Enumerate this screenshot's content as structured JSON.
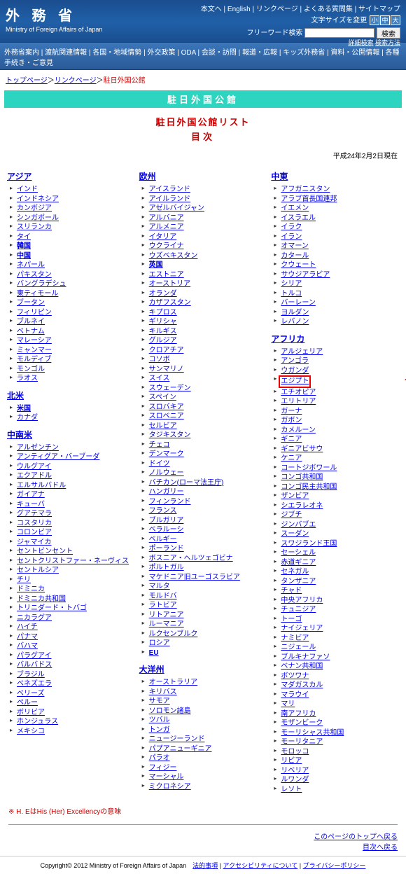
{
  "header": {
    "title": "外 務 省",
    "sub": "Ministry of Foreign Affairs of Japan",
    "topLinks": [
      "本文へ",
      "English",
      "リンクページ",
      "よくある質問集",
      "サイトマップ"
    ],
    "fontLabel": "文字サイズを変更",
    "fontBtns": [
      "小",
      "中",
      "大"
    ],
    "searchLabel": "フリーワード検索",
    "searchBtn": "検索",
    "searchSub": [
      "詳細検索",
      "検索方法"
    ]
  },
  "nav": [
    "外務省案内",
    "渡航関連情報",
    "各国・地域情勢",
    "外交政策",
    "ODA",
    "会談・訪問",
    "報道・広報",
    "キッズ外務省",
    "資料・公開情報",
    "各種手続き・ご意見"
  ],
  "bc": {
    "links": [
      "トップページ",
      "リンクページ"
    ],
    "cur": "駐日外国公館"
  },
  "banner": "駐日外国公館",
  "mainTitle": "駐日外国公館リスト",
  "subTitle": "目次",
  "date": "平成24年2月2日現在",
  "regions": {
    "asia": {
      "h": "アジア",
      "items": [
        "インド",
        "インドネシア",
        "カンボジア",
        "シンガポール",
        "スリランカ",
        "タイ",
        "韓国",
        "中国",
        "ネパール",
        "パキスタン",
        "バングラデシュ",
        "東ティモール",
        "ブータン",
        "フィリピン",
        "ブルネイ",
        "ベトナム",
        "マレーシア",
        "ミャンマー",
        "モルディブ",
        "モンゴル",
        "ラオス"
      ]
    },
    "na": {
      "h": "北米",
      "items": [
        "米国",
        "カナダ"
      ]
    },
    "la": {
      "h": "中南米",
      "items": [
        "アルゼンチン",
        "アンティグア・バーブーダ",
        "ウルグアイ",
        "エクアドル",
        "エルサルバドル",
        "ガイアナ",
        "キューバ",
        "グアテマラ",
        "コスタリカ",
        "コロンビア",
        "ジャマイカ",
        "セントビンセント",
        "セントクリストファー・ネーヴィス",
        "セントルシア",
        "チリ",
        "ドミニカ",
        "ドミニカ共和国",
        "トリニダード・トバゴ",
        "ニカラグア",
        "ハイチ",
        "パナマ",
        "バハマ",
        "パラグアイ",
        "バルバドス",
        "ブラジル",
        "ベネズエラ",
        "ベリーズ",
        "ペルー",
        "ボリビア",
        "ホンジュラス",
        "メキシコ"
      ]
    },
    "eu": {
      "h": "欧州",
      "items": [
        "アイスランド",
        "アイルランド",
        "アゼルバイジャン",
        "アルバニア",
        "アルメニア",
        "イタリア",
        "ウクライナ",
        "ウズベキスタン",
        "英国",
        "エストニア",
        "オーストリア",
        "オランダ",
        "カザフスタン",
        "キプロス",
        "ギリシャ",
        "キルギス",
        "グルジア",
        "クロアチア",
        "コソボ",
        "サンマリノ",
        "スイス",
        "スウェーデン",
        "スペイン",
        "スロバキア",
        "スロベニア",
        "セルビア",
        "タジキスタン",
        "チェコ",
        "デンマーク",
        "ドイツ",
        "ノルウェー",
        "バチカン(ローマ法王庁)",
        "ハンガリー",
        "フィンランド",
        "フランス",
        "ブルガリア",
        "ベラルーシ",
        "ベルギー",
        "ポーランド",
        "ボスニア・ヘルツェゴビナ",
        "ポルトガル",
        "マケドニア旧ユーゴスラビア",
        "マルタ",
        "モルドバ",
        "ラトビア",
        "リトアニア",
        "ルーマニア",
        "ルクセンブルク",
        "ロシア",
        "EU"
      ]
    },
    "oc": {
      "h": "大洋州",
      "items": [
        "オーストラリア",
        "キリバス",
        "サモア",
        "ソロモン諸島",
        "ツバル",
        "トンガ",
        "ニュージーランド",
        "パプアニューギニア",
        "パラオ",
        "フィジー",
        "マーシャル",
        "ミクロネシア"
      ]
    },
    "me": {
      "h": "中東",
      "items": [
        "アフガニスタン",
        "アラブ首長国連邦",
        "イエメン",
        "イスラエル",
        "イラク",
        "イラン",
        "オマーン",
        "カタール",
        "クウェート",
        "サウジアラビア",
        "シリア",
        "トルコ",
        "バーレーン",
        "ヨルダン",
        "レバノン"
      ]
    },
    "af": {
      "h": "アフリカ",
      "items": [
        "アルジェリア",
        "アンゴラ",
        "ウガンダ",
        "エジプト",
        "エチオピア",
        "エリトリア",
        "ガーナ",
        "ガボン",
        "カメルーン",
        "ギニア",
        "ギニアビサウ",
        "ケニア",
        "コートジボワール",
        "コンゴ共和国",
        "コンゴ民主共和国",
        "ザンビア",
        "シエラレオネ",
        "ジブチ",
        "ジンバブエ",
        "スーダン",
        "スワジランド王国",
        "セーシェル",
        "赤道ギニア",
        "セネガル",
        "タンザニア",
        "チャド",
        "中央アフリカ",
        "チュニジア",
        "トーゴ",
        "ナイジェリア",
        "ナミビア",
        "ニジェール",
        "ブルキナファソ",
        "ベナン共和国",
        "ボツワナ",
        "マダガスカル",
        "マラウイ",
        "マリ",
        "南アフリカ",
        "モザンビーク",
        "モーリシャス共和国",
        "モーリタニア",
        "モロッコ",
        "リビア",
        "リベリア",
        "ルワンダ",
        "レソト"
      ]
    }
  },
  "bold": [
    "韓国",
    "中国",
    "米国",
    "英国",
    "EU"
  ],
  "highlight": "エジプト",
  "note": {
    "mark": "※",
    "text": "H. EはHis (Her) Excellencyの意味"
  },
  "backLinks": [
    "このページのトップへ戻る",
    "目次へ戻る"
  ],
  "footer": {
    "copy": "Copyright© 2012 Ministry of Foreign Affairs of Japan",
    "links": [
      "法的事項",
      "アクセシビリティについて",
      "プライバシーポリシー"
    ]
  }
}
